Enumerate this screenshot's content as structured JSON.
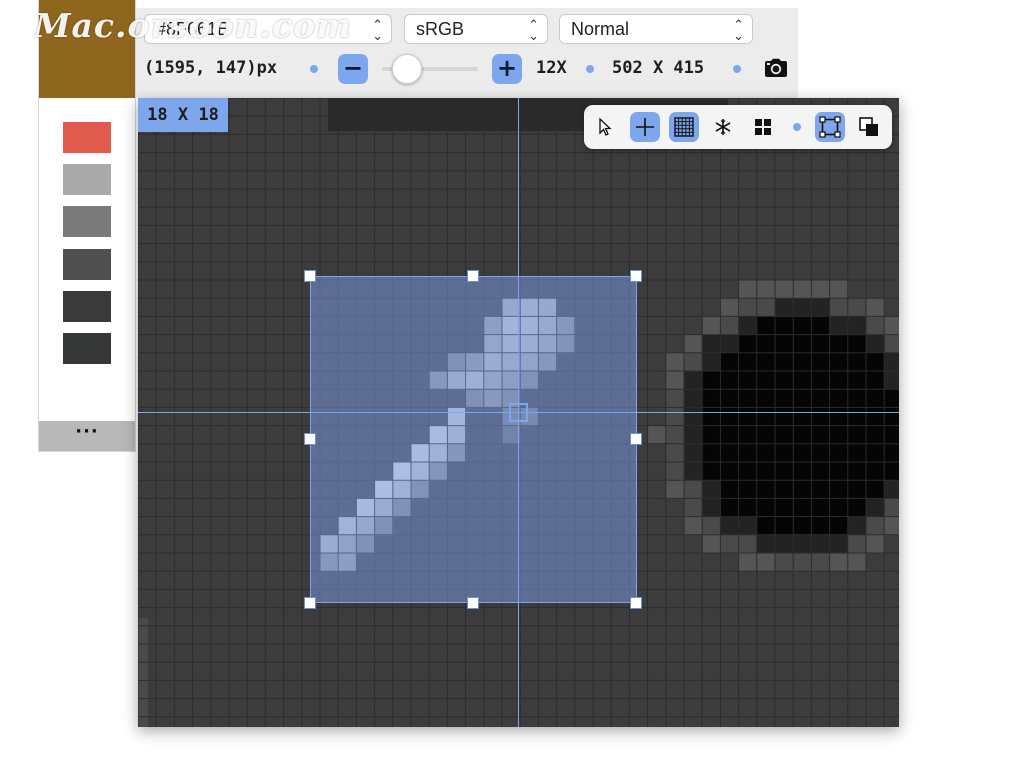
{
  "watermark": "Mac.orsoon.com",
  "toolbar": {
    "hex_value": "#8F661E",
    "color_space": "sRGB",
    "blend_mode": "Normal",
    "coordinates": "(1595, 147)px",
    "zoom_out_label": "−",
    "zoom_in_label": "+",
    "zoom_level": "12X",
    "dimensions": "502 X 415",
    "camera_icon": "camera-icon"
  },
  "swatch_panel": {
    "current_color": "#8F661E",
    "swatches": [
      "#e05a4e",
      "#a9a9a9",
      "#7b7b7b",
      "#505050",
      "#3a3a3a",
      "#363837"
    ],
    "more_label": "···"
  },
  "canvas": {
    "sample_size": "18 X 18",
    "accent_color": "#7ea6ec"
  },
  "tool_palette": {
    "tools": [
      {
        "icon": "pointer-icon",
        "active": false
      },
      {
        "icon": "crosshair-icon",
        "active": true
      },
      {
        "icon": "grid-icon",
        "active": true
      },
      {
        "icon": "snowflake-icon",
        "active": false
      },
      {
        "icon": "quad-squares-icon",
        "active": false
      },
      {
        "icon": "selection-frame-icon",
        "active": true
      },
      {
        "icon": "overlap-squares-icon",
        "active": false
      }
    ]
  }
}
